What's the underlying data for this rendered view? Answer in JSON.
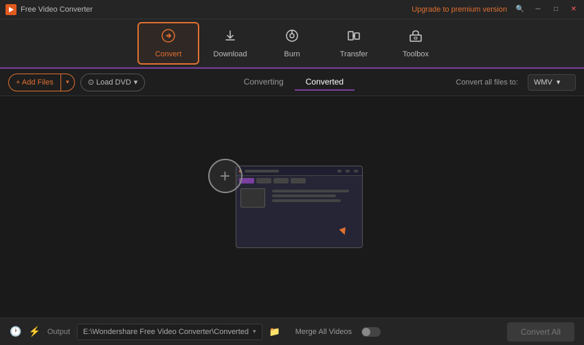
{
  "titleBar": {
    "appName": "Free Video Converter",
    "upgradeText": "Upgrade to premium version",
    "buttons": {
      "search": "🔍",
      "minimize": "─",
      "maximize": "□",
      "close": "✕"
    }
  },
  "toolbar": {
    "items": [
      {
        "id": "convert",
        "label": "Convert",
        "active": true
      },
      {
        "id": "download",
        "label": "Download",
        "active": false
      },
      {
        "id": "burn",
        "label": "Burn",
        "active": false
      },
      {
        "id": "transfer",
        "label": "Transfer",
        "active": false
      },
      {
        "id": "toolbox",
        "label": "Toolbox",
        "active": false
      }
    ]
  },
  "actionBar": {
    "addFilesLabel": "+ Add Files",
    "loadDvdLabel": "⊙ Load DVD",
    "tabs": [
      {
        "label": "Converting",
        "active": false
      },
      {
        "label": "Converted",
        "active": true
      }
    ],
    "convertAllLabel": "Convert all files to:",
    "formatValue": "WMV"
  },
  "statusBar": {
    "outputLabel": "Output",
    "outputPath": "E:\\Wondershare Free Video Converter\\Converted",
    "mergeLabel": "Merge All Videos",
    "convertAllBtn": "Convert All"
  }
}
